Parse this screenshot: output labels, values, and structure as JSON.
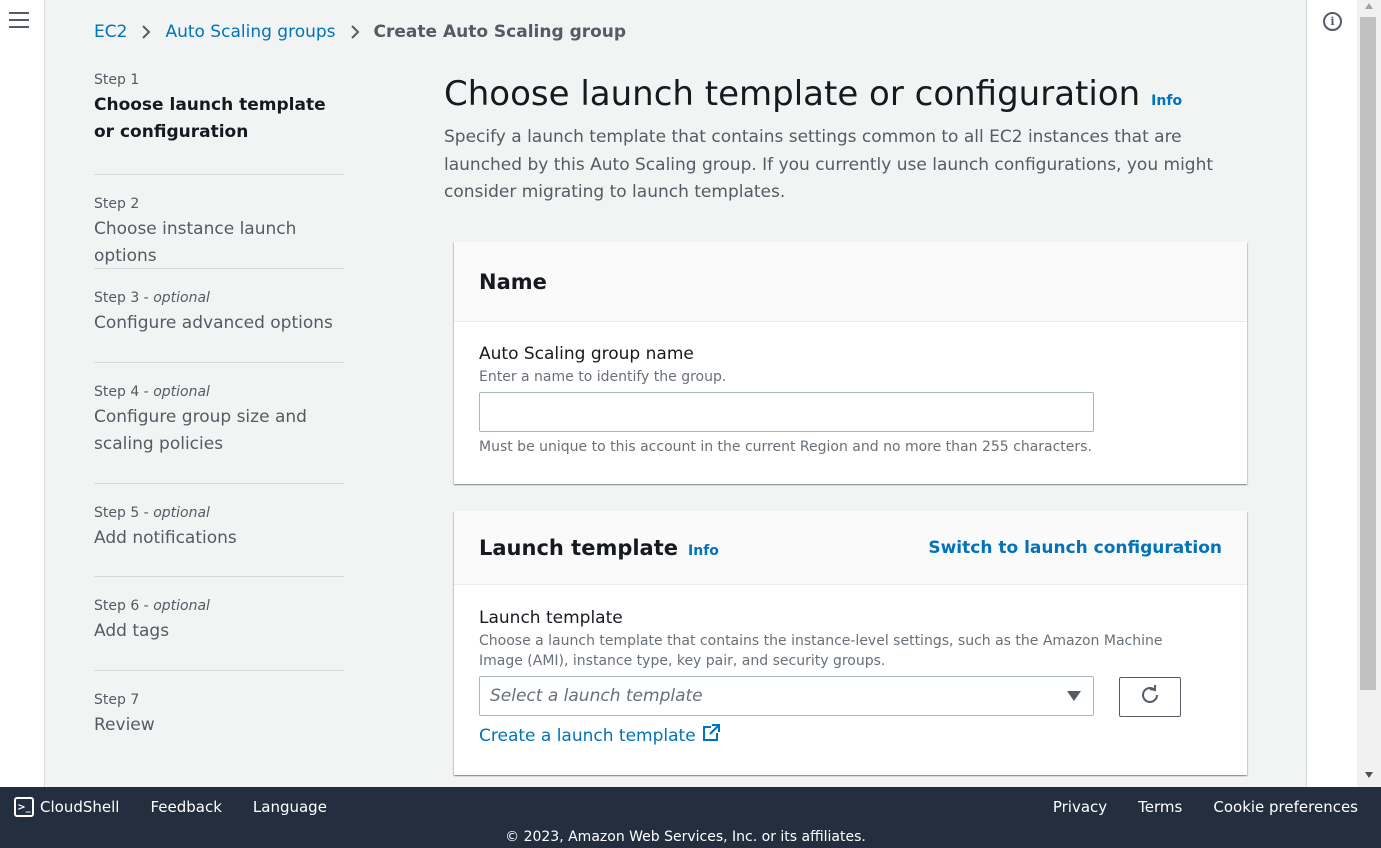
{
  "breadcrumb": {
    "items": [
      "EC2",
      "Auto Scaling groups"
    ],
    "current": "Create Auto Scaling group"
  },
  "steps": [
    {
      "label": "Step 1",
      "optional": "",
      "title": "Choose launch template or configuration"
    },
    {
      "label": "Step 2",
      "optional": "",
      "title": "Choose instance launch options"
    },
    {
      "label": "Step 3",
      "optional": "optional",
      "title": "Configure advanced options"
    },
    {
      "label": "Step 4",
      "optional": "optional",
      "title": "Configure group size and scaling policies"
    },
    {
      "label": "Step 5",
      "optional": "optional",
      "title": "Add notifications"
    },
    {
      "label": "Step 6",
      "optional": "optional",
      "title": "Add tags"
    },
    {
      "label": "Step 7",
      "optional": "",
      "title": "Review"
    }
  ],
  "main": {
    "title": "Choose launch template or configuration",
    "info": "Info",
    "description": "Specify a launch template that contains settings common to all EC2 instances that are launched by this Auto Scaling group. If you currently use launch configurations, you might consider migrating to launch templates."
  },
  "name_panel": {
    "title": "Name",
    "field_label": "Auto Scaling group name",
    "field_desc": "Enter a name to identify the group.",
    "input_value": "",
    "constraint": "Must be unique to this account in the current Region and no more than 255 characters."
  },
  "launch_panel": {
    "title": "Launch template",
    "info": "Info",
    "switch_link": "Switch to launch configuration",
    "field_label": "Launch template",
    "field_desc": "Choose a launch template that contains the instance-level settings, such as the Amazon Machine Image (AMI), instance type, key pair, and security groups.",
    "select_placeholder": "Select a launch template",
    "create_link": "Create a launch template"
  },
  "footer": {
    "cloudshell": "CloudShell",
    "feedback": "Feedback",
    "language": "Language",
    "privacy": "Privacy",
    "terms": "Terms",
    "cookies": "Cookie preferences",
    "copyright": "© 2023, Amazon Web Services, Inc. or its affiliates."
  },
  "colors": {
    "link": "#0073bb",
    "footer_bg": "#232f3e",
    "page_bg": "#f2f3f3"
  },
  "icons": {
    "menu": "hamburger-menu-icon",
    "info": "info-circle-icon",
    "refresh": "refresh-icon",
    "external": "external-link-icon",
    "cloudshell": "terminal-icon"
  }
}
